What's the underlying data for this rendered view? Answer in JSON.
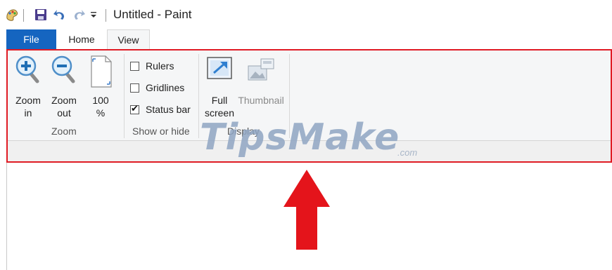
{
  "window": {
    "title": "Untitled - Paint"
  },
  "quick_access": [
    {
      "name": "paint-app-icon"
    },
    {
      "name": "save-icon"
    },
    {
      "name": "undo-icon"
    },
    {
      "name": "redo-icon"
    },
    {
      "name": "customize-dropdown-icon"
    }
  ],
  "tabs": {
    "file": "File",
    "home": "Home",
    "view": "View",
    "active": "View"
  },
  "ribbon": {
    "zoom_group": {
      "label": "Zoom",
      "zoom_in": {
        "line1": "Zoom",
        "line2": "in"
      },
      "zoom_out": {
        "line1": "Zoom",
        "line2": "out"
      },
      "zoom_100": {
        "line1": "100",
        "line2": "%"
      }
    },
    "show_hide_group": {
      "label": "Show or hide",
      "rulers": {
        "label": "Rulers",
        "checked": false
      },
      "gridlines": {
        "label": "Gridlines",
        "checked": false
      },
      "status_bar": {
        "label": "Status bar",
        "checked": true
      }
    },
    "display_group": {
      "label": "Display",
      "full_screen": {
        "line1": "Full",
        "line2": "screen"
      },
      "thumbnail": {
        "label": "Thumbnail",
        "enabled": false
      }
    }
  },
  "watermark": {
    "text": "TipsMake",
    "suffix": ".com"
  },
  "colors": {
    "file_tab": "#1565c0",
    "highlight": "#e01b24",
    "arrow": "#e01b24",
    "ribbon_bg": "#f5f6f7"
  }
}
